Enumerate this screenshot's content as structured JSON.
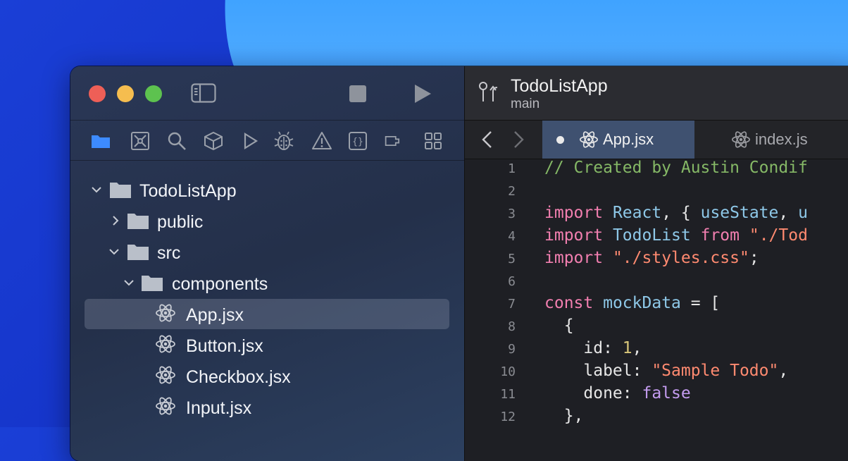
{
  "project": {
    "name": "TodoListApp",
    "branch": "main"
  },
  "colors": {
    "accent_tab": "#3f5170",
    "folder_blue": "#3d8bff"
  },
  "navigator_icons": [
    "folder-icon",
    "source-control-icon",
    "search-icon",
    "package-icon",
    "play-outline-icon",
    "bug-icon",
    "warning-icon",
    "braces-icon",
    "plug-icon",
    "grid-icon"
  ],
  "tree": [
    {
      "label": "TodoListApp",
      "type": "folder",
      "expanded": true
    },
    {
      "label": "public",
      "type": "folder",
      "expanded": false
    },
    {
      "label": "src",
      "type": "folder",
      "expanded": true
    },
    {
      "label": "components",
      "type": "folder",
      "expanded": true
    },
    {
      "label": "App.jsx",
      "type": "react-file",
      "selected": true
    },
    {
      "label": "Button.jsx",
      "type": "react-file"
    },
    {
      "label": "Checkbox.jsx",
      "type": "react-file"
    },
    {
      "label": "Input.jsx",
      "type": "react-file"
    }
  ],
  "tabs": [
    {
      "label": "App.jsx",
      "active": true,
      "modified": true
    },
    {
      "label": "index.js",
      "active": false
    }
  ],
  "code_lines": [
    {
      "n": "1",
      "tokens": [
        [
          "c-comment",
          "// Created by Austin Condif"
        ]
      ]
    },
    {
      "n": "2",
      "tokens": []
    },
    {
      "n": "3",
      "tokens": [
        [
          "c-kw",
          "import"
        ],
        [
          "c-plain",
          " "
        ],
        [
          "c-id",
          "React"
        ],
        [
          "c-plain",
          ", { "
        ],
        [
          "c-id",
          "useState"
        ],
        [
          "c-plain",
          ", "
        ],
        [
          "c-id",
          "u"
        ]
      ]
    },
    {
      "n": "4",
      "tokens": [
        [
          "c-kw",
          "import"
        ],
        [
          "c-plain",
          " "
        ],
        [
          "c-id",
          "TodoList"
        ],
        [
          "c-plain",
          " "
        ],
        [
          "c-kw",
          "from"
        ],
        [
          "c-plain",
          " "
        ],
        [
          "c-str",
          "\"./Tod"
        ]
      ]
    },
    {
      "n": "5",
      "tokens": [
        [
          "c-kw",
          "import"
        ],
        [
          "c-plain",
          " "
        ],
        [
          "c-str",
          "\"./styles.css\""
        ],
        [
          "c-plain",
          ";"
        ]
      ]
    },
    {
      "n": "6",
      "tokens": []
    },
    {
      "n": "7",
      "tokens": [
        [
          "c-kw",
          "const"
        ],
        [
          "c-plain",
          " "
        ],
        [
          "c-id",
          "mockData"
        ],
        [
          "c-plain",
          " = ["
        ]
      ]
    },
    {
      "n": "8",
      "tokens": [
        [
          "c-plain",
          "  {"
        ]
      ]
    },
    {
      "n": "9",
      "tokens": [
        [
          "c-plain",
          "    id: "
        ],
        [
          "c-num",
          "1"
        ],
        [
          "c-plain",
          ","
        ]
      ]
    },
    {
      "n": "10",
      "tokens": [
        [
          "c-plain",
          "    label: "
        ],
        [
          "c-str",
          "\"Sample Todo\""
        ],
        [
          "c-plain",
          ","
        ]
      ]
    },
    {
      "n": "11",
      "tokens": [
        [
          "c-plain",
          "    done: "
        ],
        [
          "c-bool",
          "false"
        ]
      ]
    },
    {
      "n": "12",
      "tokens": [
        [
          "c-plain",
          "  },"
        ]
      ]
    }
  ]
}
